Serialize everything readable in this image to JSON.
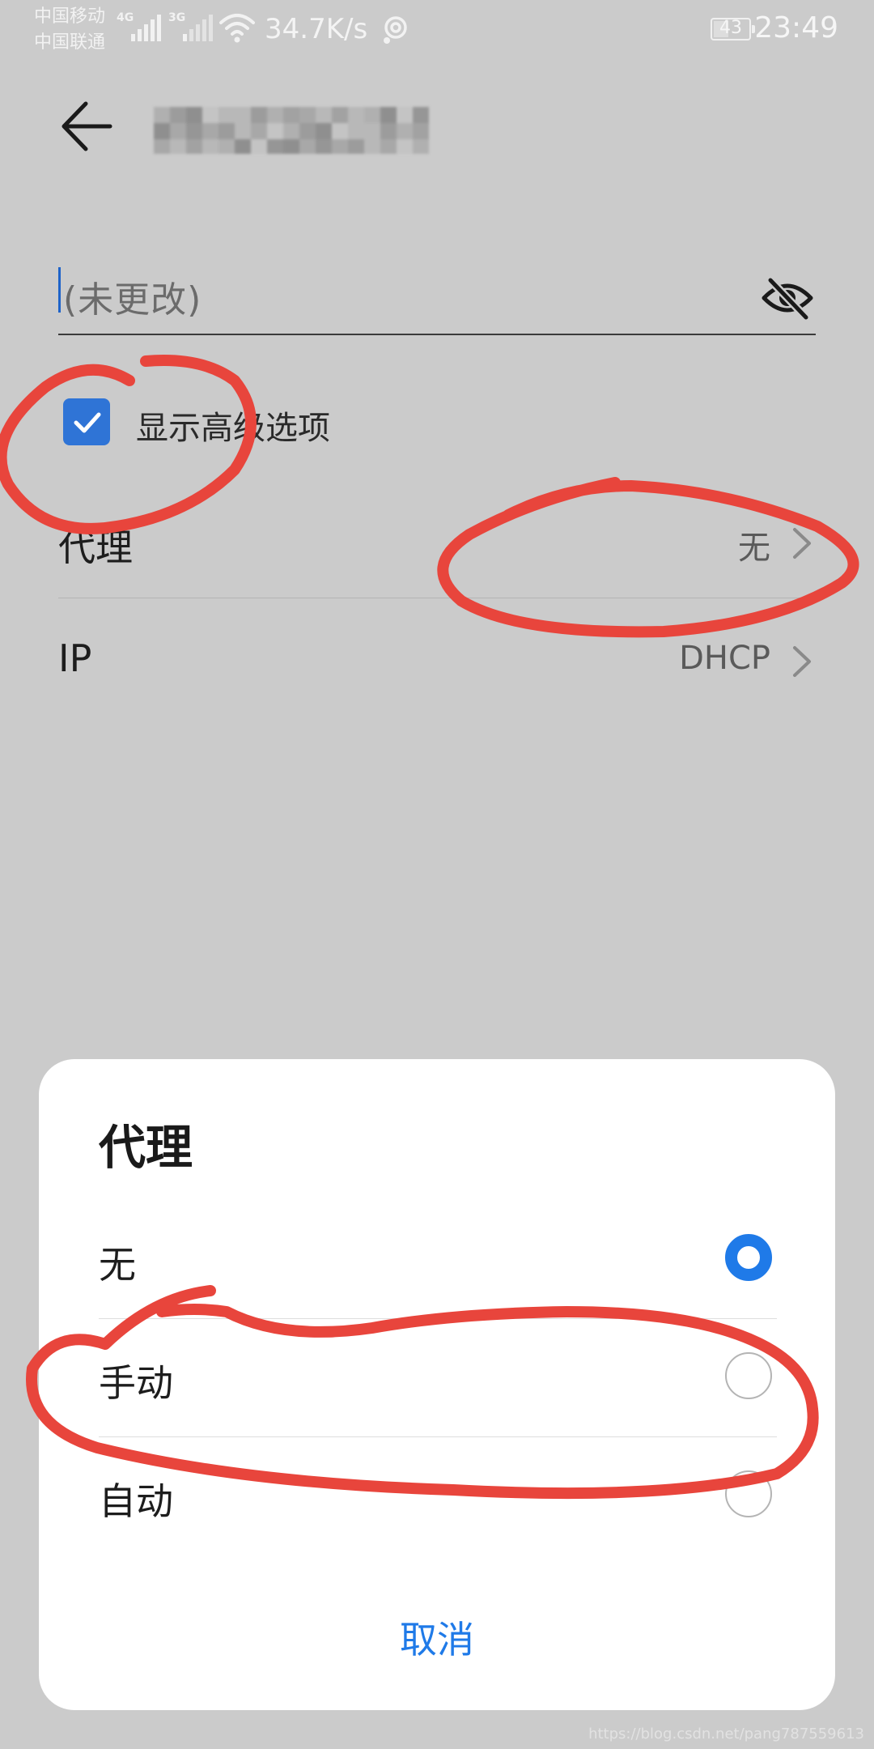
{
  "status_bar": {
    "carrier_1": "中国移动",
    "carrier_2": "中国联通",
    "network_1": "4G",
    "network_2": "3G",
    "net_speed": "34.7K/s",
    "battery": "43",
    "battery_level": 0.43,
    "time": "23:49"
  },
  "form": {
    "password_placeholder": "(未更改)",
    "advanced_options_label": "显示高级选项",
    "advanced_options_checked": true,
    "proxy": {
      "label": "代理",
      "value": "无"
    },
    "ip": {
      "label": "IP",
      "value": "DHCP"
    }
  },
  "dialog": {
    "title": "代理",
    "options": [
      {
        "label": "无",
        "selected": true
      },
      {
        "label": "手动",
        "selected": false
      },
      {
        "label": "自动",
        "selected": false
      }
    ],
    "cancel_label": "取消"
  },
  "colors": {
    "accent": "#1f7ae8",
    "checkbox": "#2f74d6",
    "annotation": "#e8453c",
    "dim_background": "#cbcbcb"
  },
  "watermark": "https://blog.csdn.net/pang787559613"
}
